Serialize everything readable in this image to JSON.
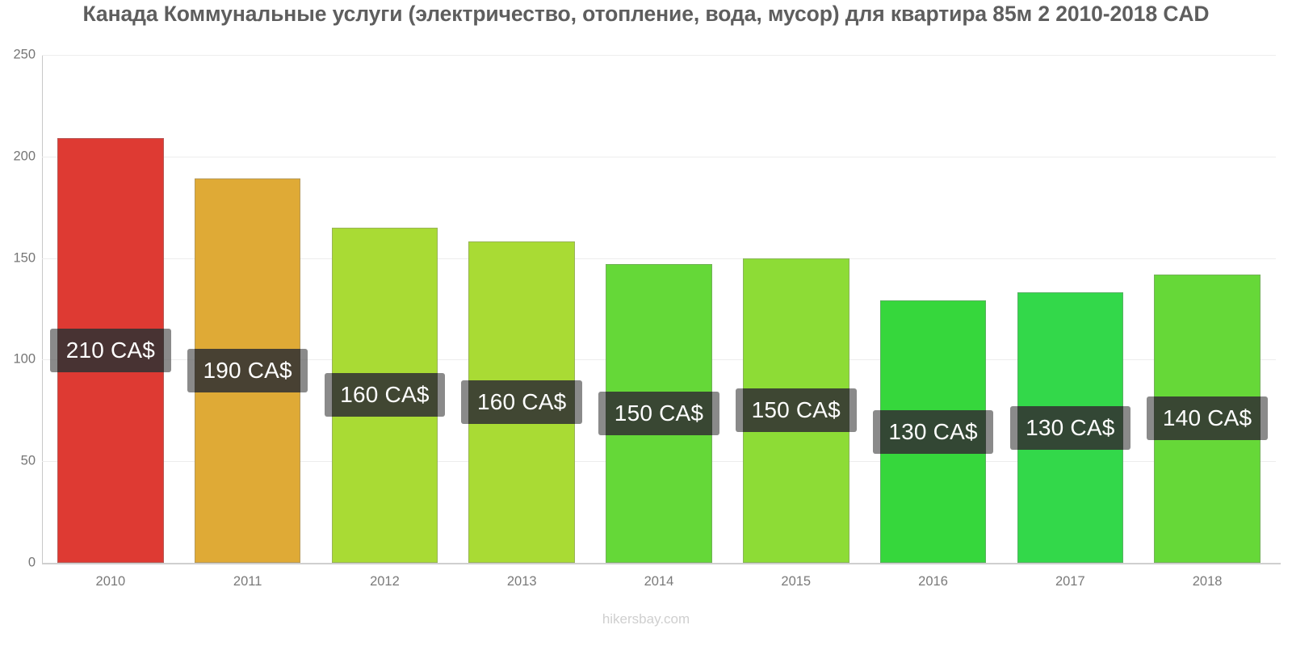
{
  "chart": {
    "title": "Канада Коммунальные услуги (электричество, отопление, вода, мусор) для квартира 85м 2 2010-2018 CAD",
    "footer": "hikersbay.com",
    "currency_suffix": "CA$"
  },
  "chart_data": {
    "type": "bar",
    "title": "Канада Коммунальные услуги (электричество, отопление, вода, мусор) для квартира 85м 2 2010-2018 CAD",
    "xlabel": "",
    "ylabel": "",
    "ylim": [
      0,
      250
    ],
    "yticks": [
      "0",
      "50",
      "100",
      "150",
      "200",
      "250"
    ],
    "ytick_values": [
      0,
      50,
      100,
      150,
      200,
      250
    ],
    "grid": true,
    "legend": false,
    "categories": [
      "2010",
      "2011",
      "2012",
      "2013",
      "2014",
      "2015",
      "2016",
      "2017",
      "2018"
    ],
    "values": [
      209,
      189,
      165,
      158,
      147,
      150,
      129,
      133,
      142
    ],
    "data_labels": [
      "210 CA$",
      "190 CA$",
      "160 CA$",
      "160 CA$",
      "150 CA$",
      "150 CA$",
      "130 CA$",
      "130 CA$",
      "140 CA$"
    ],
    "bar_colors": [
      "#de3a33",
      "#dfaa36",
      "#a9db34",
      "#a9db34",
      "#65d838",
      "#8ddc36",
      "#36d73c",
      "#33d84a",
      "#66d838"
    ],
    "bars": [
      {
        "category": "2010",
        "value": 209,
        "label": "210 CA$",
        "color": "#de3a33"
      },
      {
        "category": "2011",
        "value": 189,
        "label": "190 CA$",
        "color": "#dfaa36"
      },
      {
        "category": "2012",
        "value": 165,
        "label": "160 CA$",
        "color": "#a9db34"
      },
      {
        "category": "2013",
        "value": 158,
        "label": "160 CA$",
        "color": "#a9db34"
      },
      {
        "category": "2014",
        "value": 147,
        "label": "150 CA$",
        "color": "#65d838"
      },
      {
        "category": "2015",
        "value": 150,
        "label": "150 CA$",
        "color": "#8ddc36"
      },
      {
        "category": "2016",
        "value": 129,
        "label": "130 CA$",
        "color": "#36d73c"
      },
      {
        "category": "2017",
        "value": 133,
        "label": "130 CA$",
        "color": "#33d84a"
      },
      {
        "category": "2018",
        "value": 142,
        "label": "140 CA$",
        "color": "#66d838"
      }
    ]
  }
}
